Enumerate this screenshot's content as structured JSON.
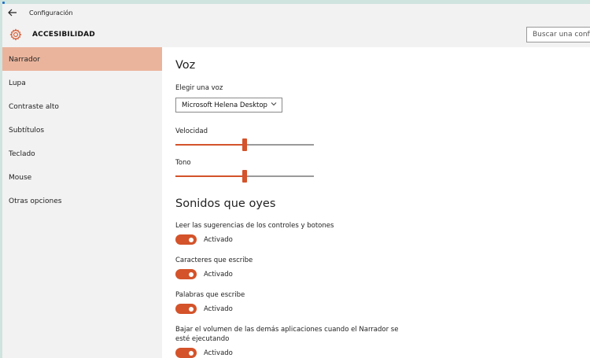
{
  "window": {
    "title": "Configuración"
  },
  "header": {
    "title": "ACCESIBILIDAD",
    "search_placeholder": "Buscar una configuración"
  },
  "sidebar": {
    "items": [
      {
        "label": "Narrador",
        "active": true
      },
      {
        "label": "Lupa"
      },
      {
        "label": "Contraste alto"
      },
      {
        "label": "Subtítulos"
      },
      {
        "label": "Teclado"
      },
      {
        "label": "Mouse"
      },
      {
        "label": "Otras opciones"
      }
    ]
  },
  "voice": {
    "heading": "Voz",
    "choose_label": "Elegir una voz",
    "voice_value": "Microsoft Helena Desktop",
    "speed_label": "Velocidad",
    "speed_level": 0.5,
    "pitch_label": "Tono",
    "pitch_level": 0.5
  },
  "sounds": {
    "heading": "Sonidos que oyes",
    "items": [
      {
        "label": "Leer las sugerencias de los controles y botones",
        "state": "Activado"
      },
      {
        "label": "Caracteres que escribe",
        "state": "Activado"
      },
      {
        "label": "Palabras que escribe",
        "state": "Activado"
      },
      {
        "label_line1": "Bajar el volumen de las demás aplicaciones cuando el Narrador se",
        "label_line2": "esté ejecutando",
        "state": "Activado"
      }
    ]
  },
  "colors": {
    "accent": "#d4532a",
    "active_nav": "#eab49c",
    "chrome": "#f2f2f2"
  },
  "icons": {
    "back": "back-arrow-icon",
    "settings": "gear-icon",
    "dropdown": "chevron-down-icon"
  }
}
